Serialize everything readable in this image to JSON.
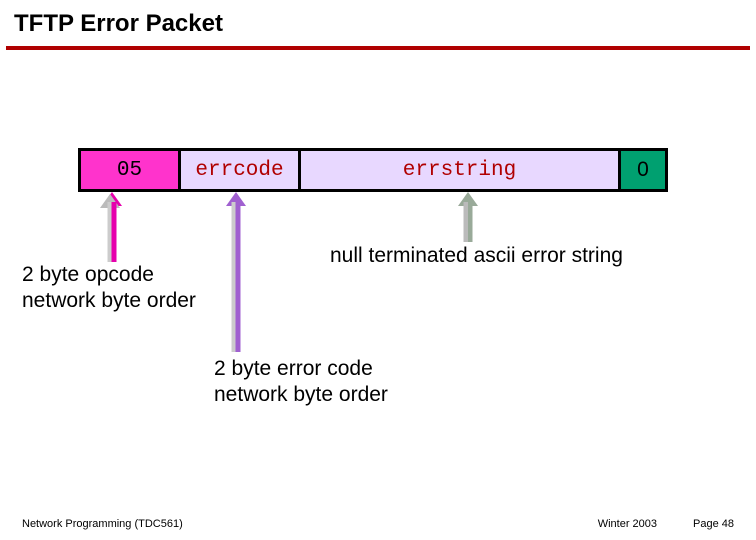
{
  "title": "TFTP Error Packet",
  "packet": {
    "opcode": "05",
    "errcode": "errcode",
    "errstring": "errstring",
    "terminator": "0"
  },
  "labels": {
    "opcode": "2 byte opcode\nnetwork byte order",
    "errstring": "null terminated ascii error string",
    "errcode": "2 byte error code\nnetwork byte order"
  },
  "footer": {
    "left": "Network Programming (TDC561)",
    "term": "Winter 2003",
    "page": "Page 48"
  }
}
